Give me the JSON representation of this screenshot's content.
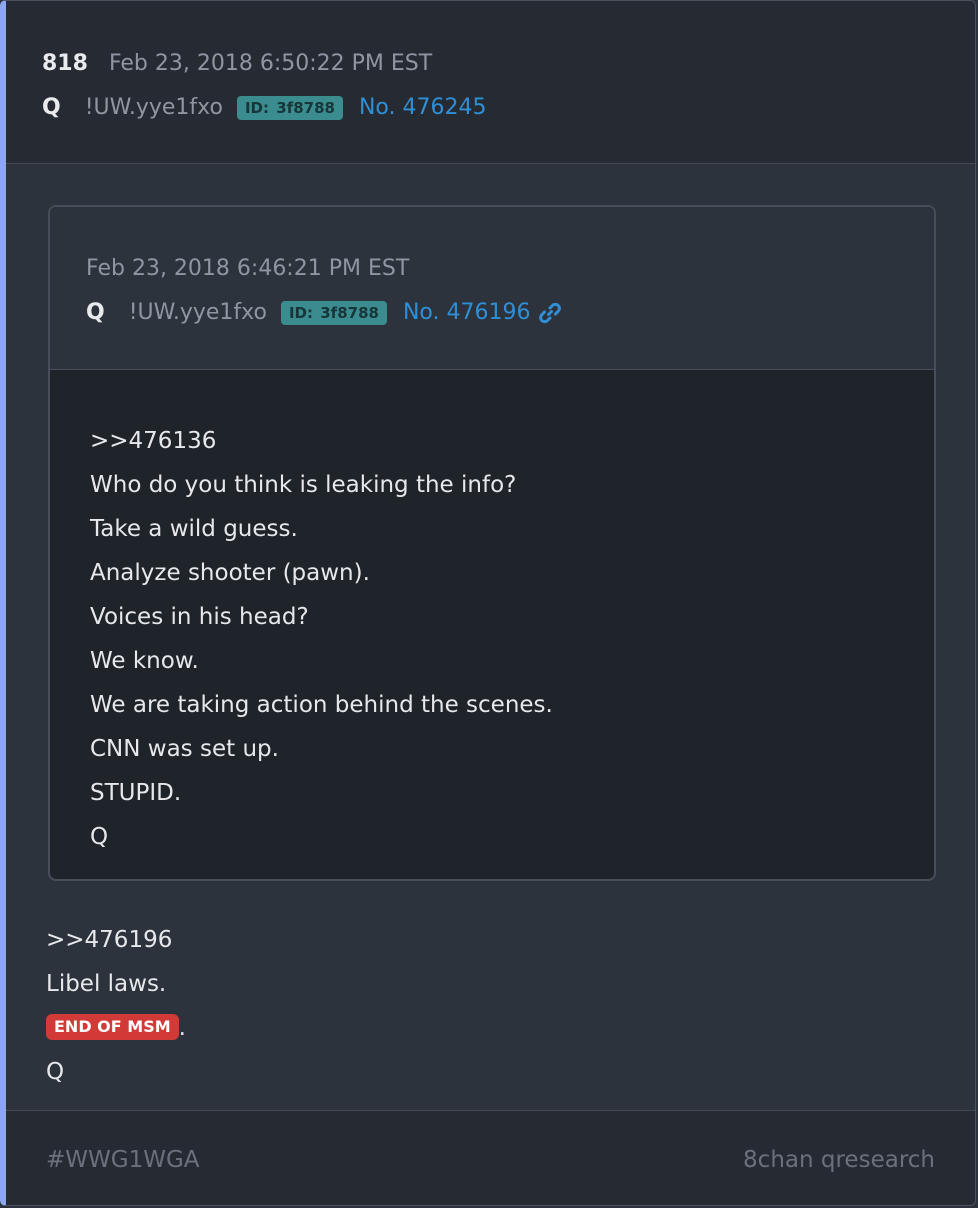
{
  "post": {
    "number": "818",
    "date": "Feb 23, 2018 6:50:22 PM EST",
    "author": "Q",
    "tripcode": "!UW.yye1fxo",
    "id_label": "ID:",
    "id_value": "3f8788",
    "post_no": "No. 476245"
  },
  "quoted": {
    "date": "Feb 23, 2018 6:46:21 PM EST",
    "author": "Q",
    "tripcode": "!UW.yye1fxo",
    "id_label": "ID:",
    "id_value": "3f8788",
    "post_no": "No. 476196",
    "lines": [
      ">>476136",
      "Who do you think is leaking the info?",
      "Take a wild guess.",
      "Analyze shooter (pawn).",
      "Voices in his head?",
      "We know.",
      "We are taking action behind the scenes.",
      "CNN was set up.",
      "STUPID.",
      "Q"
    ]
  },
  "body": {
    "line1": ">>476196",
    "line2": "Libel laws.",
    "tag": "END OF MSM",
    "tag_suffix": ".",
    "line4": "Q"
  },
  "footer": {
    "hashtag": "#WWG1WGA",
    "source": "8chan qresearch"
  },
  "colors": {
    "accent_border": "#8ea6f0",
    "link": "#2f8fd6",
    "id_badge": "#3b8c8f",
    "tag": "#d13a36"
  },
  "icons": {
    "quote_link": "link-icon"
  }
}
